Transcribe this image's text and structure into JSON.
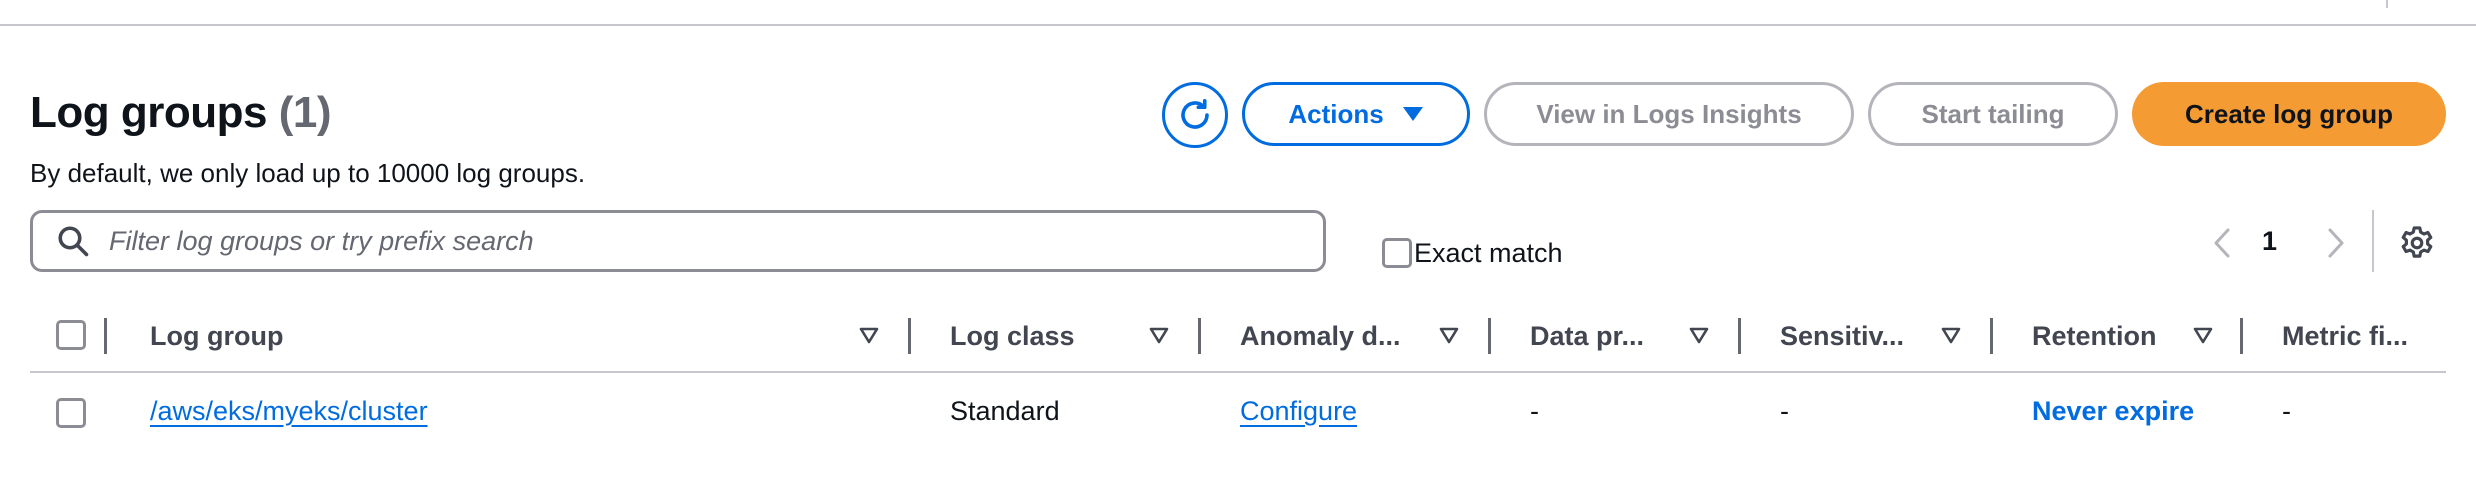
{
  "header": {
    "title": "Log groups",
    "count": "(1)",
    "subtitle": "By default, we only load up to 10000 log groups."
  },
  "toolbar": {
    "refresh_icon": "refresh-icon",
    "actions_label": "Actions",
    "insights_label": "View in Logs Insights",
    "tailing_label": "Start tailing",
    "create_label": "Create log group"
  },
  "filter": {
    "placeholder": "Filter log groups or try prefix search",
    "value": "",
    "exact_match_label": "Exact match",
    "exact_match_checked": false
  },
  "pagination": {
    "current_page": "1"
  },
  "table": {
    "columns": [
      "Log group",
      "Log class",
      "Anomaly d...",
      "Data pr...",
      "Sensitiv...",
      "Retention",
      "Metric fi..."
    ],
    "rows": [
      {
        "log_group": "/aws/eks/myeks/cluster",
        "log_class": "Standard",
        "anomaly": "Configure",
        "data_protection": "-",
        "sensitive": "-",
        "retention": "Never expire",
        "metric_filters": "-"
      }
    ]
  },
  "colors": {
    "accent": "#006ce0",
    "primary_button": "#f59b33",
    "disabled": "#8c8c94"
  }
}
